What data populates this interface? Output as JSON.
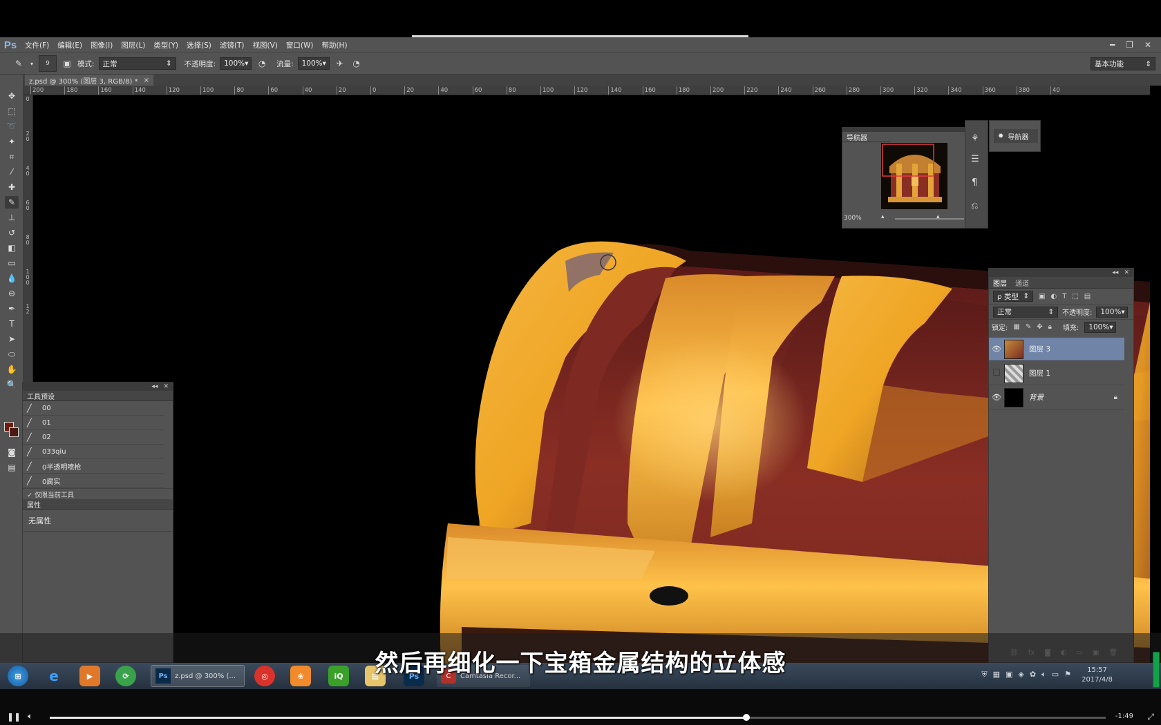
{
  "app": {
    "logo": "Ps"
  },
  "menu": [
    "文件(F)",
    "编辑(E)",
    "图像(I)",
    "图层(L)",
    "类型(Y)",
    "选择(S)",
    "滤镜(T)",
    "视图(V)",
    "窗口(W)",
    "帮助(H)"
  ],
  "window_controls": {
    "minimize": "━",
    "restore": "❐",
    "close": "✕"
  },
  "options": {
    "brush_size": "9",
    "mode_label": "模式:",
    "mode_value": "正常",
    "opacity_label": "不透明度:",
    "opacity_value": "100%",
    "flow_label": "流量:",
    "flow_value": "100%",
    "workspace": "基本功能"
  },
  "document": {
    "tab_title": "z.psd @ 300% (图层 3, RGB/8) *",
    "close": "×"
  },
  "ruler": {
    "h_ticks": [
      "200",
      "180",
      "160",
      "140",
      "120",
      "100",
      "80",
      "60",
      "40",
      "20",
      "0",
      "20",
      "40",
      "60",
      "80",
      "100",
      "120",
      "140",
      "160",
      "180",
      "200",
      "220",
      "240",
      "260",
      "280",
      "300",
      "320",
      "340",
      "360",
      "380",
      "40"
    ],
    "v_ticks": [
      "0",
      "2 0",
      "4 0",
      "6 0",
      "8 0",
      "1 0 0",
      "1 2"
    ]
  },
  "tool_presets": {
    "title": "工具预设",
    "items": [
      "00",
      "01",
      "02",
      "033qiu",
      "0半透明喷枪",
      "0腐实"
    ],
    "current_only": "✓ 仅限当前工具"
  },
  "properties": {
    "title": "属性",
    "body": "无属性"
  },
  "navigator": {
    "title": "导航器",
    "zoom": "300%",
    "float_label": "导航器"
  },
  "layers": {
    "tabs": [
      "图层",
      "通道"
    ],
    "filter_kind": "ρ 类型",
    "blend_mode": "正常",
    "opacity_label": "不透明度:",
    "opacity_value": "100%",
    "lock_label": "锁定:",
    "fill_label": "填充:",
    "fill_value": "100%",
    "items": [
      {
        "name": "图层 3",
        "visible": true,
        "selected": true
      },
      {
        "name": "图层 1",
        "visible": false,
        "selected": false
      },
      {
        "name": "背景",
        "visible": true,
        "selected": false,
        "locked": true
      }
    ]
  },
  "taskbar": {
    "ps_task": "z.psd @ 300% (...",
    "camtasia_task": "Camtasia Recor...",
    "clock_time": "15:57",
    "clock_date": "2017/4/8"
  },
  "subtitle": "然后再细化一下宝箱金属结构的立体感",
  "player": {
    "progress": 0.66,
    "remaining": "-1:49"
  },
  "colors": {
    "accent_selected_layer": "#6f84a6",
    "foreground": "#6b1d12",
    "ui_panel": "#535353"
  }
}
